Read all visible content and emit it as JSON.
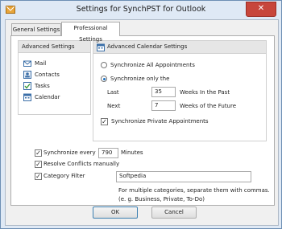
{
  "window": {
    "title": "Settings for SynchPST for Outlook",
    "close_glyph": "✕"
  },
  "tabs": [
    {
      "label": "General Settings",
      "active": false
    },
    {
      "label": "Professional Settings",
      "active": true
    }
  ],
  "sidebar": {
    "header": "Advanced Settings",
    "items": [
      {
        "label": "Mail",
        "icon": "mail-icon"
      },
      {
        "label": "Contacts",
        "icon": "contacts-icon"
      },
      {
        "label": "Tasks",
        "icon": "tasks-icon"
      },
      {
        "label": "Calendar",
        "icon": "calendar-icon"
      }
    ]
  },
  "calendar": {
    "header": "Advanced Calendar Settings",
    "sync_all_label": "Synchronize All Appointments",
    "sync_only_label": "Synchronize only the",
    "last_label": "Last",
    "last_value": "35",
    "last_suffix": "Weeks In the Past",
    "next_label": "Next",
    "next_value": "7",
    "next_suffix": "Weeks of the Future",
    "private_label": "Synchronize Private Appointments",
    "sync_all_selected": false,
    "sync_only_selected": true,
    "private_checked": true
  },
  "options": {
    "sync_every_label": "Synchronize every",
    "sync_every_value": "790",
    "sync_every_unit": "Minutes",
    "sync_every_checked": true,
    "resolve_label": "Resolve Conflicts manually",
    "resolve_checked": true,
    "category_label": "Category Filter",
    "category_checked": true,
    "category_value": "Softpedia",
    "category_help1": "For multiple categories, separate them with commas.",
    "category_help2": "(e. g. Business, Private, To-Do)"
  },
  "buttons": {
    "ok": "OK",
    "cancel": "Cancel"
  },
  "colors": {
    "accent": "#1c6fbf",
    "title_bar": "#dfe9f5",
    "close": "#c7463b"
  }
}
